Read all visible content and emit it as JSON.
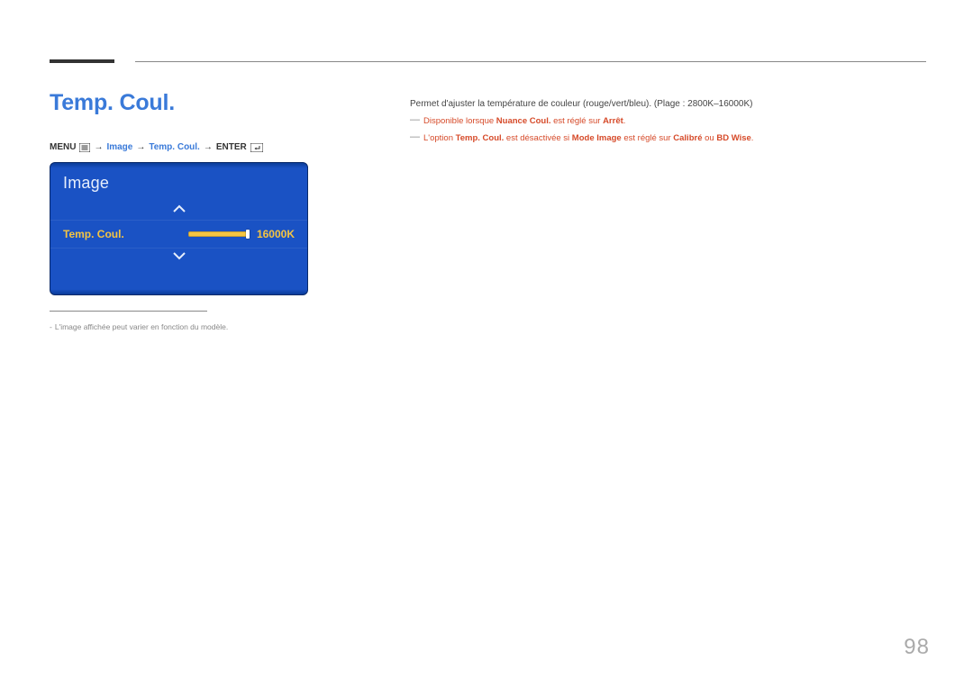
{
  "page": {
    "title": "Temp. Coul.",
    "number": "98"
  },
  "nav": {
    "menu_label": "MENU",
    "arrow": "→",
    "p1": "Image",
    "p2": "Temp. Coul.",
    "enter_label": "ENTER"
  },
  "menu": {
    "title": "Image",
    "row_label": "Temp. Coul.",
    "row_value": "16000K"
  },
  "footnote": {
    "dash": "-",
    "text": "L'image affichée peut varier en fonction du modèle."
  },
  "body": {
    "desc": "Permet d'ajuster la température de couleur (rouge/vert/bleu). (Plage : 2800K–16000K)",
    "note1": {
      "pre": "Disponible lorsque ",
      "b1": "Nuance Coul.",
      "mid": " est réglé sur ",
      "b2": "Arrêt",
      "post": "."
    },
    "note2": {
      "pre": "L'option ",
      "b1": "Temp. Coul.",
      "mid1": " est désactivée si ",
      "b2": "Mode Image",
      "mid2": " est réglé sur ",
      "b3": "Calibré",
      "or": " ou ",
      "b4": "BD Wise",
      "post": "."
    }
  },
  "icons": {
    "menu": "menu-icon",
    "enter": "enter-icon",
    "up": "chevron-up-icon",
    "down": "chevron-down-icon"
  }
}
